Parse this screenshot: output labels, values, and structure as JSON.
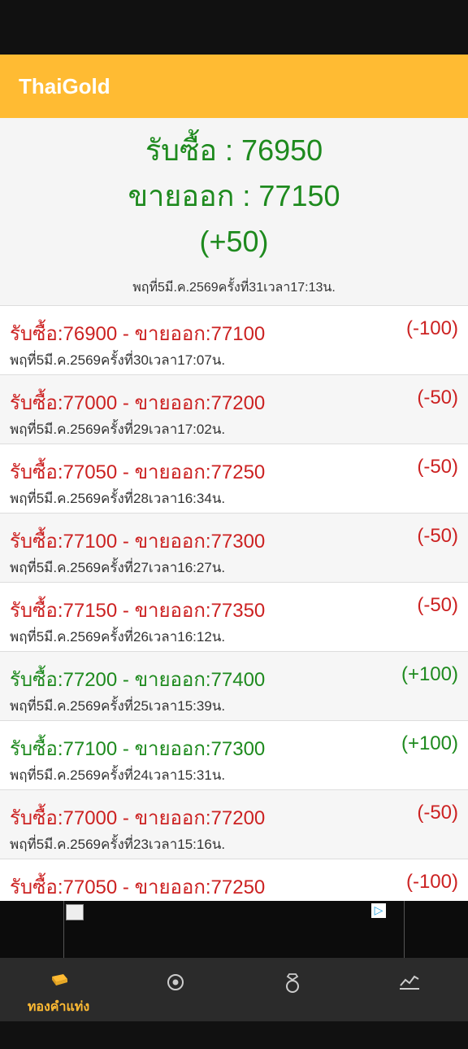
{
  "app": {
    "title": "ThaiGold"
  },
  "current": {
    "buy": "รับซื้อ : 76950",
    "sell": "ขายออก : 77150",
    "change": "(+50)",
    "time": "พฤที่5มี.ค.2569ครั้งที่31เวลา17:13น."
  },
  "history": [
    {
      "main": "รับซื้อ:76900 - ขายออก:77100",
      "change": "(-100)",
      "time": "พฤที่5มี.ค.2569ครั้งที่30เวลา17:07น.",
      "trend": "down"
    },
    {
      "main": "รับซื้อ:77000 - ขายออก:77200",
      "change": "(-50)",
      "time": "พฤที่5มี.ค.2569ครั้งที่29เวลา17:02น.",
      "trend": "down"
    },
    {
      "main": "รับซื้อ:77050 - ขายออก:77250",
      "change": "(-50)",
      "time": "พฤที่5มี.ค.2569ครั้งที่28เวลา16:34น.",
      "trend": "down"
    },
    {
      "main": "รับซื้อ:77100 - ขายออก:77300",
      "change": "(-50)",
      "time": "พฤที่5มี.ค.2569ครั้งที่27เวลา16:27น.",
      "trend": "down"
    },
    {
      "main": "รับซื้อ:77150 - ขายออก:77350",
      "change": "(-50)",
      "time": "พฤที่5มี.ค.2569ครั้งที่26เวลา16:12น.",
      "trend": "down"
    },
    {
      "main": "รับซื้อ:77200 - ขายออก:77400",
      "change": "(+100)",
      "time": "พฤที่5มี.ค.2569ครั้งที่25เวลา15:39น.",
      "trend": "up"
    },
    {
      "main": "รับซื้อ:77100 - ขายออก:77300",
      "change": "(+100)",
      "time": "พฤที่5มี.ค.2569ครั้งที่24เวลา15:31น.",
      "trend": "up"
    },
    {
      "main": "รับซื้อ:77000 - ขายออก:77200",
      "change": "(-50)",
      "time": "พฤที่5มี.ค.2569ครั้งที่23เวลา15:16น.",
      "trend": "down"
    },
    {
      "main": "รับซื้อ:77050 - ขายออก:77250",
      "change": "(-100)",
      "time": "",
      "trend": "down"
    }
  ],
  "nav": {
    "items": [
      {
        "label": "ทองคำแท่ง",
        "icon": "gold-bar-icon",
        "active": true
      },
      {
        "label": "",
        "icon": "circle-target-icon",
        "active": false
      },
      {
        "label": "",
        "icon": "ring-icon",
        "active": false
      },
      {
        "label": "",
        "icon": "trend-chart-icon",
        "active": false
      }
    ]
  },
  "colors": {
    "accent": "#FFBB33",
    "up": "#1e8a1e",
    "down": "#cc2222"
  }
}
